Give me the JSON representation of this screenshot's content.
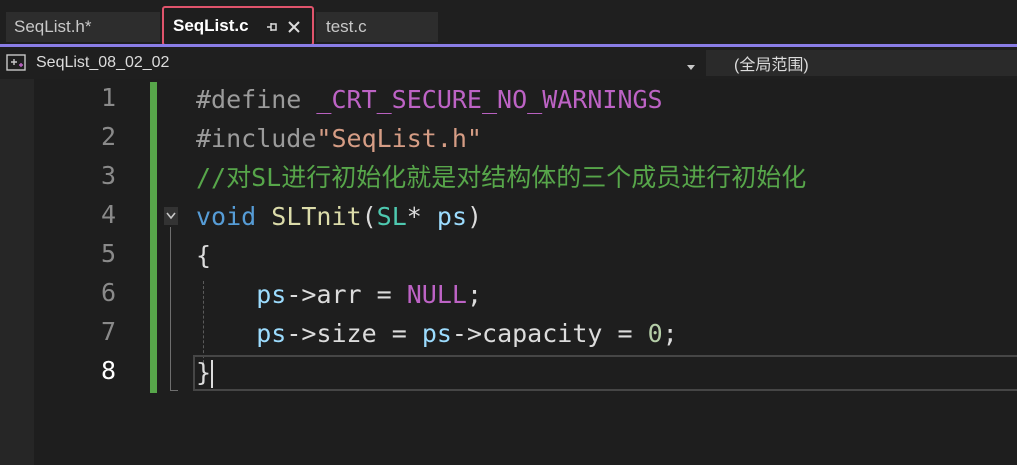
{
  "tabs": [
    {
      "label": "SeqList.h*"
    },
    {
      "label": "SeqList.c"
    },
    {
      "label": "test.c"
    }
  ],
  "nav": {
    "project": "SeqList_08_02_02",
    "scope": "(全局范围)"
  },
  "code": {
    "line_numbers": [
      "1",
      "2",
      "3",
      "4",
      "5",
      "6",
      "7",
      "8"
    ],
    "line1": {
      "directive": "#define",
      "macro": "_CRT_SECURE_NO_WARNINGS"
    },
    "line2": {
      "directive": "#include",
      "path": "\"SeqList.h\""
    },
    "line3": {
      "comment": "//对SL进行初始化就是对结构体的三个成员进行初始化"
    },
    "line4": {
      "keyword": "void",
      "func": "SLTnit",
      "open": "(",
      "type": "SL",
      "star": "*",
      "param": "ps",
      "close": ")"
    },
    "line5": {
      "text": "{"
    },
    "line6": {
      "var": "ps",
      "arrow": "->",
      "field": "arr",
      "op": " = ",
      "value": "NULL",
      "end": ";"
    },
    "line7": {
      "var": "ps",
      "arrow": "->",
      "field": "size",
      "op": " = ",
      "var2": "ps",
      "arrow2": "->",
      "field2": "capacity",
      "op2": " = ",
      "value": "0",
      "end": ";"
    },
    "line8": {
      "text": "}"
    }
  },
  "colors": {
    "accent": "#8a7de6",
    "active_tab_border": "#e0546c",
    "change_bar": "#57a64a"
  },
  "icons": {
    "pin": "pin-icon",
    "close": "close-icon",
    "scope": "class-scope-icon",
    "dropdown": "chevron-down-icon"
  }
}
